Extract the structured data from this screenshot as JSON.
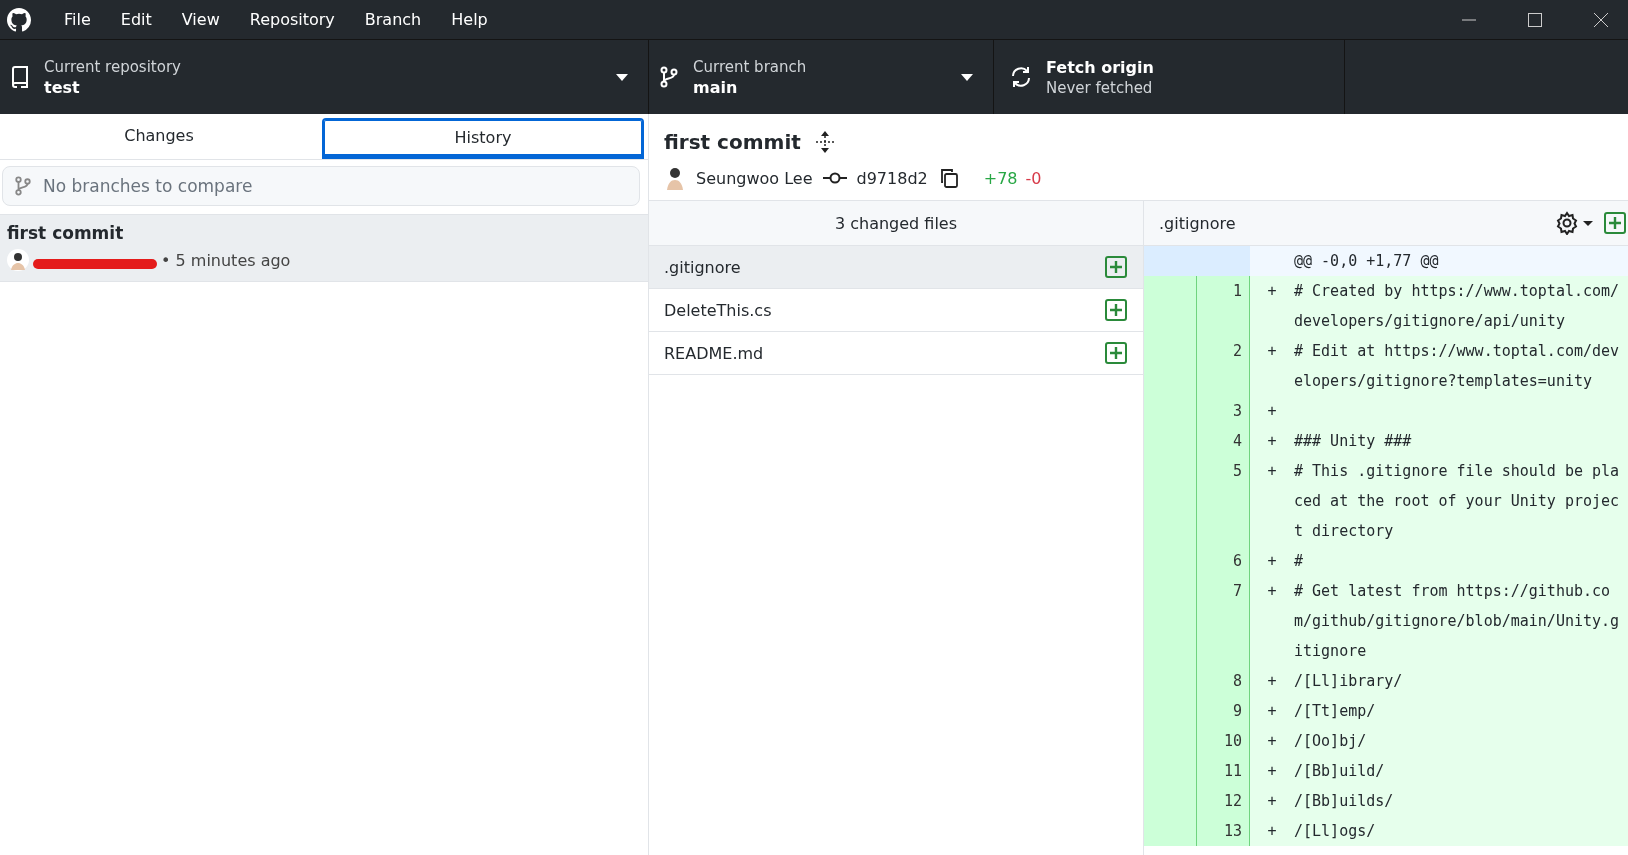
{
  "menu_bar": {
    "items": [
      "File",
      "Edit",
      "View",
      "Repository",
      "Branch",
      "Help"
    ]
  },
  "toolbar": [
    {
      "kind": "repository",
      "label": "Current repository",
      "value": "test"
    },
    {
      "kind": "branch",
      "label": "Current branch",
      "value": "main"
    },
    {
      "kind": "fetch",
      "label": "Fetch origin",
      "value": "Never fetched"
    }
  ],
  "tabs": [
    {
      "label": "Changes",
      "selected": false
    },
    {
      "label": "History",
      "selected": true
    }
  ],
  "compare": {
    "placeholder": "No branches to compare"
  },
  "commits": [
    {
      "title": "first commit",
      "time": "• 5 minutes ago",
      "selected": true,
      "redacted": true
    }
  ],
  "commit": {
    "title": "first commit",
    "author": "Seungwoo Lee",
    "sha": "d9718d2",
    "additions": "+78",
    "deletions": "-0"
  },
  "files": {
    "header": "3 changed files",
    "items": [
      {
        "name": ".gitignore",
        "selected": true
      },
      {
        "name": "DeleteThis.cs",
        "selected": false
      },
      {
        "name": "README.md",
        "selected": false
      }
    ]
  },
  "diff": {
    "file": ".gitignore",
    "hunk": "@@ -0,0 +1,77 @@",
    "lines": [
      {
        "number": "1",
        "sign": "+",
        "text": [
          "# Created by https://www.toptal.com/",
          "developers/gitignore/api/unity"
        ]
      },
      {
        "number": "2",
        "sign": "+",
        "text": [
          "# Edit at https://www.toptal.com/dev",
          "elopers/gitignore?templates=unity"
        ]
      },
      {
        "number": "3",
        "sign": "+"
      },
      {
        "number": "4",
        "sign": "+",
        "text": [
          "### Unity ###"
        ]
      },
      {
        "number": "5",
        "sign": "+",
        "text": [
          "# This .gitignore file should be pla",
          "ced at the root of your Unity projec",
          "t directory"
        ]
      },
      {
        "number": "6",
        "sign": "+",
        "text": [
          "#"
        ]
      },
      {
        "number": "7",
        "sign": "+",
        "text": [
          "# Get latest from https://github.co",
          "m/github/gitignore/blob/main/Unity.g",
          "itignore"
        ]
      },
      {
        "number": "8",
        "sign": "+",
        "text": [
          "/[Ll]ibrary/"
        ]
      },
      {
        "number": "9",
        "sign": "+",
        "text": [
          "/[Tt]emp/"
        ]
      },
      {
        "number": "10",
        "sign": "+",
        "text": [
          "/[Oo]bj/"
        ]
      },
      {
        "number": "11",
        "sign": "+",
        "text": [
          "/[Bb]uild/"
        ]
      },
      {
        "number": "12",
        "sign": "+",
        "text": [
          "/[Bb]uilds/"
        ]
      },
      {
        "number": "13",
        "sign": "+",
        "text": [
          "/[Ll]ogs/"
        ]
      }
    ]
  }
}
